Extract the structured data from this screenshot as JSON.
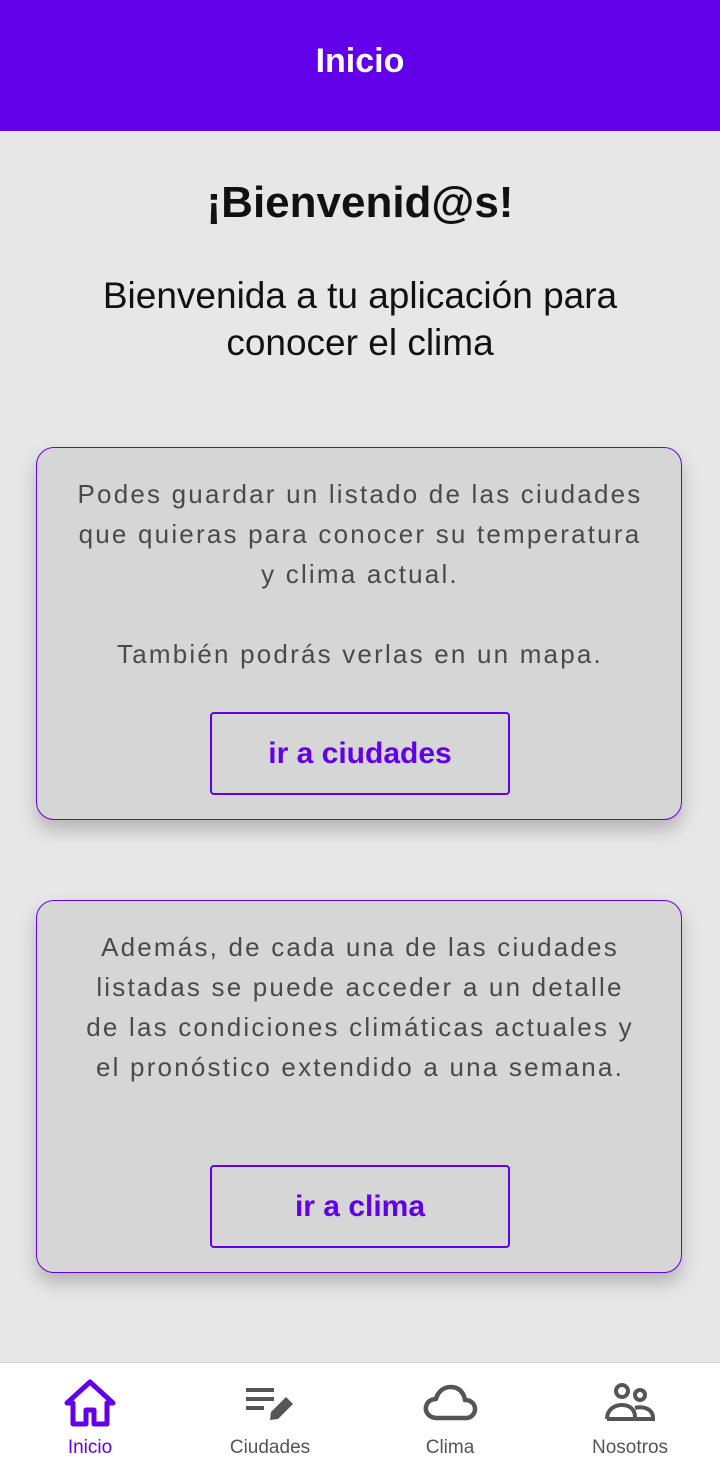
{
  "colors": {
    "primary": "#6200ea",
    "background": "#e7e7e7",
    "card": "#d6d6d6",
    "nav_inactive": "#555555"
  },
  "app_bar": {
    "title": "Inicio"
  },
  "welcome": {
    "title": "¡Bienvenid@s!",
    "subtitle": "Bienvenida a tu aplicación para conocer el clima"
  },
  "cards": [
    {
      "text": "Podes guardar un listado de las ciudades que quieras para conocer su temperatura y clima actual.\n\nTambién podrás verlas en un mapa.",
      "button_label": "ir a ciudades"
    },
    {
      "text": "Además, de cada una de las ciudades listadas se puede acceder a un detalle de las condiciones climáticas actuales y el pronóstico extendido a una semana.",
      "button_label": "ir a clima"
    }
  ],
  "bottom_nav": {
    "items": [
      {
        "label": "Inicio",
        "icon": "home-icon",
        "active": true
      },
      {
        "label": "Ciudades",
        "icon": "edit-list-icon",
        "active": false
      },
      {
        "label": "Clima",
        "icon": "cloud-icon",
        "active": false
      },
      {
        "label": "Nosotros",
        "icon": "people-icon",
        "active": false
      }
    ]
  }
}
